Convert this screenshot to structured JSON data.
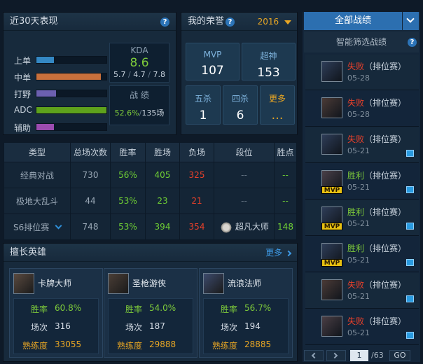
{
  "recent": {
    "title": "近30天表现",
    "roles": [
      {
        "label": "上单",
        "fill": 0.25,
        "color": "#3488c4"
      },
      {
        "label": "中单",
        "fill": 0.92,
        "color": "#c8703c"
      },
      {
        "label": "打野",
        "fill": 0.28,
        "color": "#6c60b0"
      },
      {
        "label": "ADC",
        "fill": 1.0,
        "color": "#5ea21c"
      },
      {
        "label": "辅助",
        "fill": 0.25,
        "color": "#9c4cb0"
      }
    ],
    "kda_label": "KDA",
    "kda_value": "8.6",
    "kda_k": "5.7",
    "kda_d": "4.7",
    "kda_a": "7.8",
    "record_label": "战 绩",
    "record_rate": "52.6%",
    "record_games": "135场"
  },
  "honor": {
    "title": "我的荣誉",
    "year": "2016",
    "mvp_label": "MVP",
    "mvp_value": "107",
    "god_label": "超神",
    "god_value": "153",
    "penta_label": "五杀",
    "penta_value": "1",
    "quadra_label": "四杀",
    "quadra_value": "6",
    "more_label": "更多",
    "more_value": "…"
  },
  "table": {
    "headers": [
      "类型",
      "总场次数",
      "胜率",
      "胜场",
      "负场",
      "段位",
      "胜点"
    ],
    "rows": [
      {
        "type": "经典对战",
        "total": "730",
        "rate": "56%",
        "win": "405",
        "lose": "325",
        "rank": "--",
        "points": "--"
      },
      {
        "type": "极地大乱斗",
        "total": "44",
        "rate": "53%",
        "win": "23",
        "lose": "21",
        "rank": "--",
        "points": "--"
      },
      {
        "type": "S6排位赛",
        "total": "748",
        "rate": "53%",
        "win": "394",
        "lose": "354",
        "rank": "超凡大师",
        "points": "148"
      }
    ]
  },
  "heroes": {
    "title": "擅长英雄",
    "more": "更多",
    "rate_label": "胜率",
    "games_label": "场次",
    "mastery_label": "熟练度",
    "list": [
      {
        "name": "卡牌大师",
        "rate": "60.8%",
        "games": "316",
        "mastery": "33055",
        "color": "#5a4a40"
      },
      {
        "name": "圣枪游侠",
        "rate": "54.0%",
        "games": "187",
        "mastery": "29888",
        "color": "#4a3e36"
      },
      {
        "name": "流浪法师",
        "rate": "56.7%",
        "games": "194",
        "mastery": "28885",
        "color": "#3c4a6c"
      }
    ]
  },
  "side": {
    "all_label": "全部战绩",
    "filter_label": "智能筛选战绩",
    "mvp_badge": "MVP",
    "matches": [
      {
        "result": "失败",
        "mode": "（排位赛）",
        "date": "05-28",
        "win": false,
        "mvp": false,
        "icon": false,
        "color": "#2e3d58"
      },
      {
        "result": "失败",
        "mode": "（排位赛）",
        "date": "05-28",
        "win": false,
        "mvp": false,
        "icon": false,
        "color": "#4a3a36"
      },
      {
        "result": "失败",
        "mode": "（排位赛）",
        "date": "05-21",
        "win": false,
        "mvp": false,
        "icon": true,
        "color": "#2e3d58"
      },
      {
        "result": "胜利",
        "mode": "（排位赛）",
        "date": "05-21",
        "win": true,
        "mvp": true,
        "icon": true,
        "color": "#4a4048"
      },
      {
        "result": "胜利",
        "mode": "（排位赛）",
        "date": "05-21",
        "win": true,
        "mvp": true,
        "icon": true,
        "color": "#2e3d58"
      },
      {
        "result": "胜利",
        "mode": "（排位赛）",
        "date": "05-21",
        "win": true,
        "mvp": true,
        "icon": true,
        "color": "#2e3d58"
      },
      {
        "result": "失败",
        "mode": "（排位赛）",
        "date": "05-21",
        "win": false,
        "mvp": false,
        "icon": true,
        "color": "#4a3a36"
      },
      {
        "result": "失败",
        "mode": "（排位赛）",
        "date": "05-21",
        "win": false,
        "mvp": false,
        "icon": true,
        "color": "#4a3e44"
      }
    ],
    "page_current": "1",
    "page_total": "/63",
    "go_label": "GO"
  }
}
